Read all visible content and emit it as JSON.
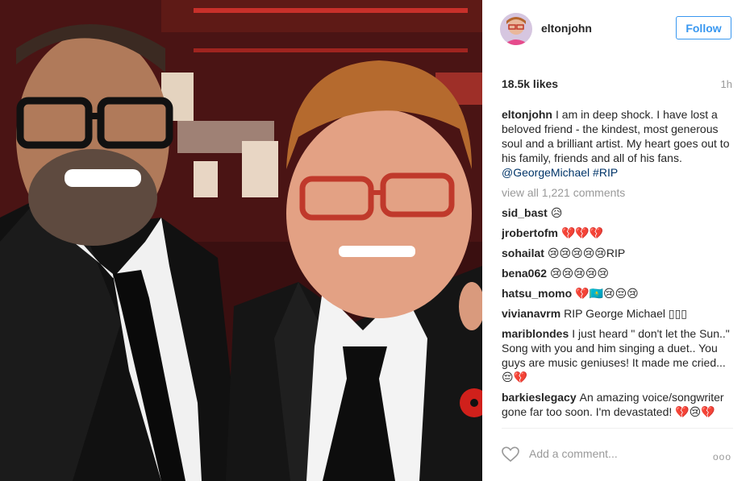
{
  "photo": {
    "alt": "George Michael and Elton John"
  },
  "header": {
    "username": "eltonjohn",
    "follow_label": "Follow"
  },
  "post": {
    "likes": "18.5k likes",
    "time": "1h",
    "caption_user": "eltonjohn",
    "caption_text": "I am in deep shock. I have lost a beloved friend - the kindest, most generous soul and a brilliant artist. My heart goes out to his family, friends and all of his fans.",
    "caption_mention": "@GeorgeMichael",
    "caption_hashtag": "#RIP",
    "view_all": "view all 1,221 comments"
  },
  "comments": [
    {
      "user": "sid_bast",
      "text": "😥"
    },
    {
      "user": "jrobertofm",
      "text": "💔💔💔"
    },
    {
      "user": "sohailat",
      "text": "😢😢😢😢😢RIP"
    },
    {
      "user": "bena062",
      "text": "😢😢😢😢😢"
    },
    {
      "user": "hatsu_momo",
      "text": "💔🇰🇿😢😔😢"
    },
    {
      "user": "vivianavrm",
      "text": "RIP George Michael ▯▯▯"
    },
    {
      "user": "mariblondes",
      "text": "I just heard \" don't let the Sun..\" Song with you and him singing a duet.. You guys are music geniuses! It made me cried... 😔💔"
    },
    {
      "user": "barkieslegacy",
      "text": "An amazing voice/songwriter gone far too soon. I'm devastated! 💔😢💔"
    }
  ],
  "footer": {
    "add_comment_placeholder": "Add a comment...",
    "more_label": "ooo"
  },
  "colors": {
    "accent": "#3897f0",
    "link": "#003569",
    "muted": "#999999"
  }
}
